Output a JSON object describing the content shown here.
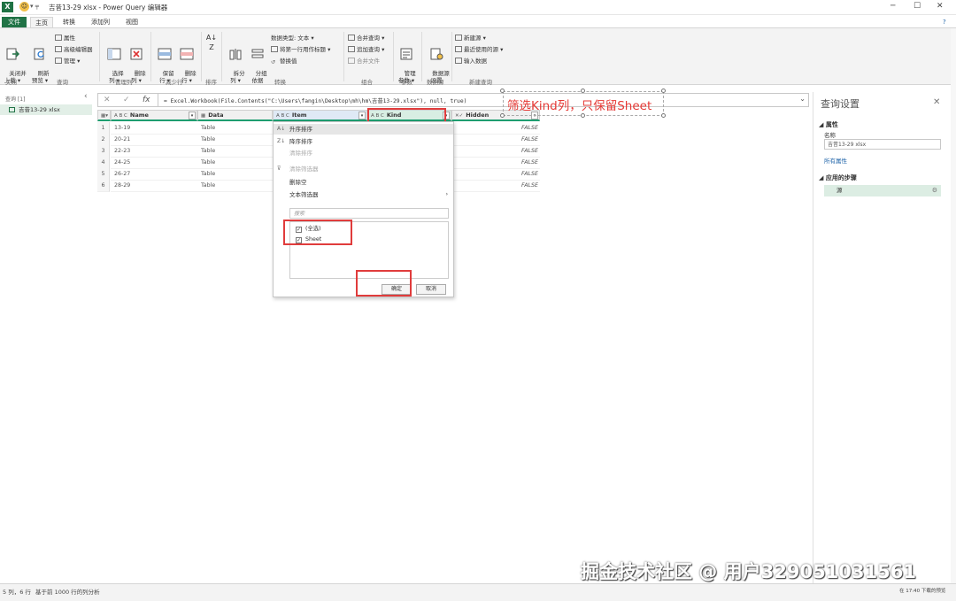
{
  "titlebar": {
    "qat": "▾ ╤",
    "title": "吉昔13-29 xlsx - Power Query 编辑器",
    "minimize": "─",
    "maximize": "☐",
    "close": "✕"
  },
  "menu": {
    "file": "文件",
    "home": "主页",
    "transform": "转换",
    "add_column": "添加列",
    "view": "视图",
    "help": "?"
  },
  "ribbon": {
    "close_apply": "关闭并\n上载 ▾",
    "refresh": "刷新\n预览 ▾",
    "properties": "属性",
    "adv_editor": "高级编辑器",
    "manage": "管理 ▾",
    "choose_cols": "选择\n列 ▾",
    "remove_cols": "删除\n列 ▾",
    "keep_rows": "保留\n行 ▾",
    "remove_rows": "删除\n行 ▾",
    "split_col": "拆分\n列 ▾",
    "group_by": "分组\n依据",
    "data_type": "数据类型: 文本 ▾",
    "first_row_header": "将第一行用作标题 ▾",
    "replace_values": "替换值",
    "merge_queries": "合并查询 ▾",
    "append_queries": "追加查询 ▾",
    "combine_files": "合并文件",
    "manage_params": "管理\n参数 ▾",
    "data_source_settings": "数据源\n设置",
    "new_source": "新建源 ▾",
    "recent_sources": "最近使用的源 ▾",
    "enter_data": "输入数据",
    "groups": {
      "close": "关闭",
      "query": "查询",
      "manage_cols": "管理列",
      "reduce_rows": "减少行",
      "sort": "排序",
      "transform": "转换",
      "combine": "组合",
      "params": "参数",
      "data_source": "数据源",
      "new_query": "新建查询"
    }
  },
  "queries_pane": {
    "title": "查询 [1]",
    "item": "吉昔13-29 xlsx",
    "collapse": "‹"
  },
  "formula": {
    "cancel": "✕",
    "confirm": "✓",
    "fx": "fx",
    "text": "= Excel.Workbook(File.Contents(\"C:\\Users\\fangin\\Desktop\\mh\\hm\\吉昔13-29.xlsx\"), null, true)",
    "expand": "⌄"
  },
  "grid": {
    "headers": [
      {
        "type": "A B C",
        "name": "Name"
      },
      {
        "type": "▦",
        "name": "Data"
      },
      {
        "type": "A B C",
        "name": "Item"
      },
      {
        "type": "A B C",
        "name": "Kind"
      },
      {
        "type": "✕✓",
        "name": "Hidden"
      }
    ],
    "rows": [
      {
        "n": "1",
        "name": "13-19",
        "data": "Table",
        "hidden": "FALSE"
      },
      {
        "n": "2",
        "name": "20-21",
        "data": "Table",
        "hidden": "FALSE"
      },
      {
        "n": "3",
        "name": "22-23",
        "data": "Table",
        "hidden": "FALSE"
      },
      {
        "n": "4",
        "name": "24-25",
        "data": "Table",
        "hidden": "FALSE"
      },
      {
        "n": "5",
        "name": "26-27",
        "data": "Table",
        "hidden": "FALSE"
      },
      {
        "n": "6",
        "name": "28-29",
        "data": "Table",
        "hidden": "FALSE"
      }
    ]
  },
  "filter_menu": {
    "sort_asc": "升序排序",
    "sort_desc": "降序排序",
    "clear_sort": "清除排序",
    "clear_filter": "清除筛选器",
    "remove_empty": "删除空",
    "text_filters": "文本筛选器",
    "search_placeholder": "搜索",
    "select_all": "(全选)",
    "sheet": "Sheet",
    "ok": "确定",
    "cancel": "取消"
  },
  "annotation": "筛选Kind列，只保留Sheet",
  "settings": {
    "title": "查询设置",
    "close": "✕",
    "properties": "◢ 属性",
    "name_label": "名称",
    "name_value": "吉昔13-29 xlsx",
    "all_props": "所有属性",
    "applied_steps": "◢ 应用的步骤",
    "step": "源",
    "gear": "⚙"
  },
  "status": {
    "left": "5 列，6 行",
    "mid": "基于前 1000 行的列分析",
    "right": "在 17:40 下载的预览"
  },
  "watermark": "掘金技术社区 @ 用户329051031561"
}
